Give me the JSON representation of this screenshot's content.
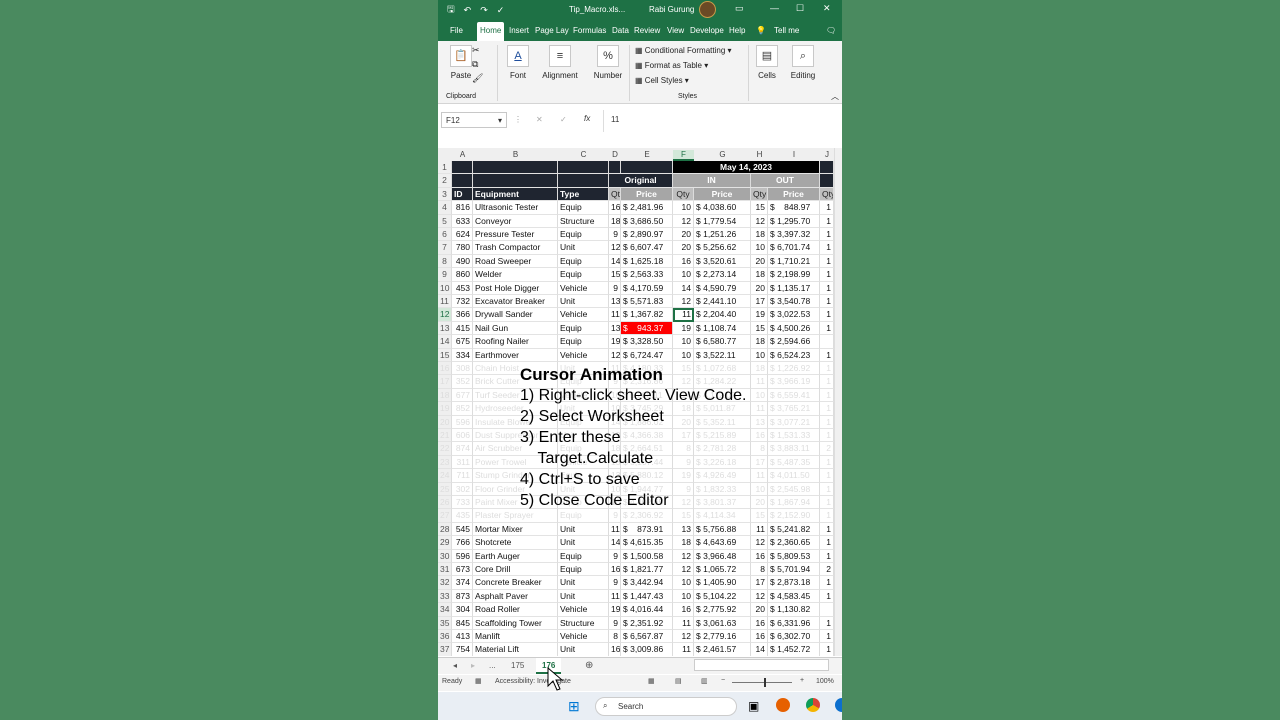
{
  "titlebar": {
    "filename": "Tip_Macro.xls...",
    "user": "Rabi Gurung"
  },
  "tabs": [
    "File",
    "Home",
    "Insert",
    "Page Lay",
    "Formulas",
    "Data",
    "Review",
    "View",
    "Develope",
    "Help",
    "Tell me"
  ],
  "ribbon": {
    "paste": "Paste",
    "clipboard": "Clipboard",
    "font": "Font",
    "alignment": "Alignment",
    "number": "Number",
    "cond": "Conditional Formatting",
    "fat": "Format as Table",
    "cs": "Cell Styles",
    "styles": "Styles",
    "cells": "Cells",
    "editing": "Editing"
  },
  "formula": {
    "name_box": "F12",
    "value": "11"
  },
  "columns": [
    "A",
    "B",
    "C",
    "D",
    "E",
    "F",
    "G",
    "H",
    "I",
    "J"
  ],
  "headers": {
    "date": "May 14, 2023",
    "original": "Original",
    "in": "IN",
    "out": "OUT",
    "id": "ID",
    "equipment": "Equipment",
    "type": "Type",
    "qty": "Qty",
    "price": "Price"
  },
  "rows": [
    [
      "4",
      "816",
      "Ultrasonic Tester",
      "Equip",
      "16",
      "$ 2,481.96",
      "10",
      "$ 4,038.60",
      "15",
      "$    848.97",
      "1"
    ],
    [
      "5",
      "633",
      "Conveyor",
      "Structure",
      "18",
      "$ 3,686.50",
      "12",
      "$ 1,779.54",
      "12",
      "$ 1,295.70",
      "1"
    ],
    [
      "6",
      "624",
      "Pressure Tester",
      "Equip",
      "9",
      "$ 2,890.97",
      "20",
      "$ 1,251.26",
      "18",
      "$ 3,397.32",
      "1"
    ],
    [
      "7",
      "780",
      "Trash Compactor",
      "Unit",
      "12",
      "$ 6,607.47",
      "20",
      "$ 5,256.62",
      "10",
      "$ 6,701.74",
      "1"
    ],
    [
      "8",
      "490",
      "Road Sweeper",
      "Equip",
      "14",
      "$ 1,625.18",
      "16",
      "$ 3,520.61",
      "20",
      "$ 1,710.21",
      "1"
    ],
    [
      "9",
      "860",
      "Welder",
      "Equip",
      "15",
      "$ 2,563.33",
      "10",
      "$ 2,273.14",
      "18",
      "$ 2,198.99",
      "1"
    ],
    [
      "10",
      "453",
      "Post Hole Digger",
      "Vehicle",
      "9",
      "$ 4,170.59",
      "14",
      "$ 4,590.79",
      "20",
      "$ 1,135.17",
      "1"
    ],
    [
      "11",
      "732",
      "Excavator Breaker",
      "Unit",
      "13",
      "$ 5,571.83",
      "12",
      "$ 2,441.10",
      "17",
      "$ 3,540.78",
      "1"
    ],
    [
      "12",
      "366",
      "Drywall Sander",
      "Vehicle",
      "11",
      "$ 1,367.82",
      "11",
      "$ 2,204.40",
      "19",
      "$ 3,022.53",
      "1"
    ],
    [
      "13",
      "415",
      "Nail Gun",
      "Equip",
      "13",
      "$    943.37",
      "19",
      "$ 1,108.74",
      "15",
      "$ 4,500.26",
      "1"
    ],
    [
      "14",
      "675",
      "Roofing Nailer",
      "Equip",
      "19",
      "$ 3,328.50",
      "10",
      "$ 6,580.77",
      "18",
      "$ 2,594.66",
      ""
    ],
    [
      "15",
      "334",
      "Earthmover",
      "Vehicle",
      "12",
      "$ 6,724.47",
      "10",
      "$ 3,522.11",
      "10",
      "$ 6,524.23",
      "1"
    ]
  ],
  "faded_rows": [
    [
      "16",
      "308",
      "Chain Hoist",
      "Unit",
      "11",
      "$ 4,180.33",
      "15",
      "$ 1,072.68",
      "18",
      "$ 1,226.92",
      "1"
    ],
    [
      "17",
      "352",
      "Brick Cutter",
      "Equip",
      "9",
      "$ 2,316.86",
      "12",
      "$ 1,284.22",
      "11",
      "$ 3,966.19",
      "1"
    ],
    [
      "18",
      "677",
      "Turf Seeder",
      "Vehicle",
      "16",
      "$ 5,208.11",
      "14",
      "$ 4,112.07",
      "10",
      "$ 6,559.41",
      "1"
    ],
    [
      "19",
      "852",
      "Hydroseeder",
      "Unit",
      "10",
      "$ 3,745.29",
      "18",
      "$ 5,011.87",
      "11",
      "$ 3,765.21",
      "1"
    ],
    [
      "20",
      "596",
      "Insulate Blower",
      "Equip",
      "14",
      "$ 1,886.02",
      "20",
      "$ 5,352.11",
      "13",
      "$ 3,077.21",
      "1"
    ],
    [
      "21",
      "606",
      "Dust Suppressor",
      "Unit",
      "12",
      "$ 4,366.38",
      "17",
      "$ 5,215.89",
      "16",
      "$ 1,531.33",
      "1"
    ],
    [
      "22",
      "874",
      "Air Scrubber",
      "Equip",
      "18",
      "$ 2,664.51",
      "8",
      "$ 2,781.28",
      "8",
      "$ 3,883.11",
      "2"
    ],
    [
      "23",
      "311",
      "Power Trowel",
      "Vehicle",
      "15",
      "$ 3,107.44",
      "9",
      "$ 3,226.18",
      "17",
      "$ 5,487.35",
      "1"
    ],
    [
      "24",
      "711",
      "Stump Grinder",
      "Equip",
      "13",
      "$ 5,880.12",
      "19",
      "$ 4,926.49",
      "11",
      "$ 4,011.50",
      "1"
    ],
    [
      "25",
      "302",
      "Floor Grinder",
      "Unit",
      "10",
      "$ 1,944.77",
      "9",
      "$ 1,832.33",
      "10",
      "$ 2,545.98",
      "1"
    ],
    [
      "26",
      "733",
      "Paint Mixer",
      "Equip",
      "16",
      "$ 4,402.65",
      "12",
      "$ 3,801.37",
      "20",
      "$ 1,867.94",
      "1"
    ],
    [
      "27",
      "435",
      "Plaster Sprayer",
      "Equip",
      "9",
      "$ 2,306.92",
      "15",
      "$ 4,114.34",
      "15",
      "$ 2,152.90",
      "1"
    ]
  ],
  "rows2": [
    [
      "28",
      "545",
      "Mortar Mixer",
      "Unit",
      "11",
      "$    873.91",
      "13",
      "$ 5,756.88",
      "11",
      "$ 5,241.82",
      "1"
    ],
    [
      "29",
      "766",
      "Shotcrete",
      "Unit",
      "14",
      "$ 4,615.35",
      "18",
      "$ 4,643.69",
      "12",
      "$ 2,360.65",
      "1"
    ],
    [
      "30",
      "596",
      "Earth Auger",
      "Equip",
      "9",
      "$ 1,500.58",
      "12",
      "$ 3,966.48",
      "16",
      "$ 5,809.53",
      "1"
    ],
    [
      "31",
      "673",
      "Core Drill",
      "Equip",
      "16",
      "$ 1,821.77",
      "12",
      "$ 1,065.72",
      "8",
      "$ 5,701.94",
      "2"
    ],
    [
      "32",
      "374",
      "Concrete Breaker",
      "Unit",
      "9",
      "$ 3,442.94",
      "10",
      "$ 1,405.90",
      "17",
      "$ 2,873.18",
      "1"
    ],
    [
      "33",
      "873",
      "Asphalt Paver",
      "Unit",
      "11",
      "$ 1,447.43",
      "10",
      "$ 5,104.22",
      "12",
      "$ 4,583.45",
      "1"
    ],
    [
      "34",
      "304",
      "Road Roller",
      "Vehicle",
      "19",
      "$ 4,016.44",
      "16",
      "$ 2,775.92",
      "20",
      "$ 1,130.82",
      ""
    ],
    [
      "35",
      "845",
      "Scaffolding Tower",
      "Structure",
      "9",
      "$ 2,351.92",
      "11",
      "$ 3,061.63",
      "16",
      "$ 6,331.96",
      "1"
    ],
    [
      "36",
      "413",
      "Manlift",
      "Vehicle",
      "8",
      "$ 6,567.87",
      "12",
      "$ 2,779.16",
      "16",
      "$ 6,302.70",
      "1"
    ],
    [
      "37",
      "754",
      "Material Lift",
      "Unit",
      "16",
      "$ 3,009.86",
      "11",
      "$ 2,461.57",
      "14",
      "$ 1,452.72",
      "1"
    ]
  ],
  "sheet_tabs": {
    "ellipsis": "...",
    "prev": "175",
    "active": "176"
  },
  "status": {
    "ready": "Ready",
    "accessibility": "Accessibility: Investigate",
    "zoom": "100%"
  },
  "taskbar": {
    "search": "Search"
  },
  "overlay": {
    "title": "Cursor Animation",
    "l1": "1) Right-click sheet. View Code.",
    "l2": "2) Select Worksheet",
    "l3": "3) Enter these",
    "l4": "    Target.Calculate",
    "l5": "4) Ctrl+S to save",
    "l6": "5) Close Code Editor"
  },
  "colors": {
    "excel_green": "#1e7145",
    "highlight_red": "#ff0000",
    "header_dark": "#1f2530"
  }
}
